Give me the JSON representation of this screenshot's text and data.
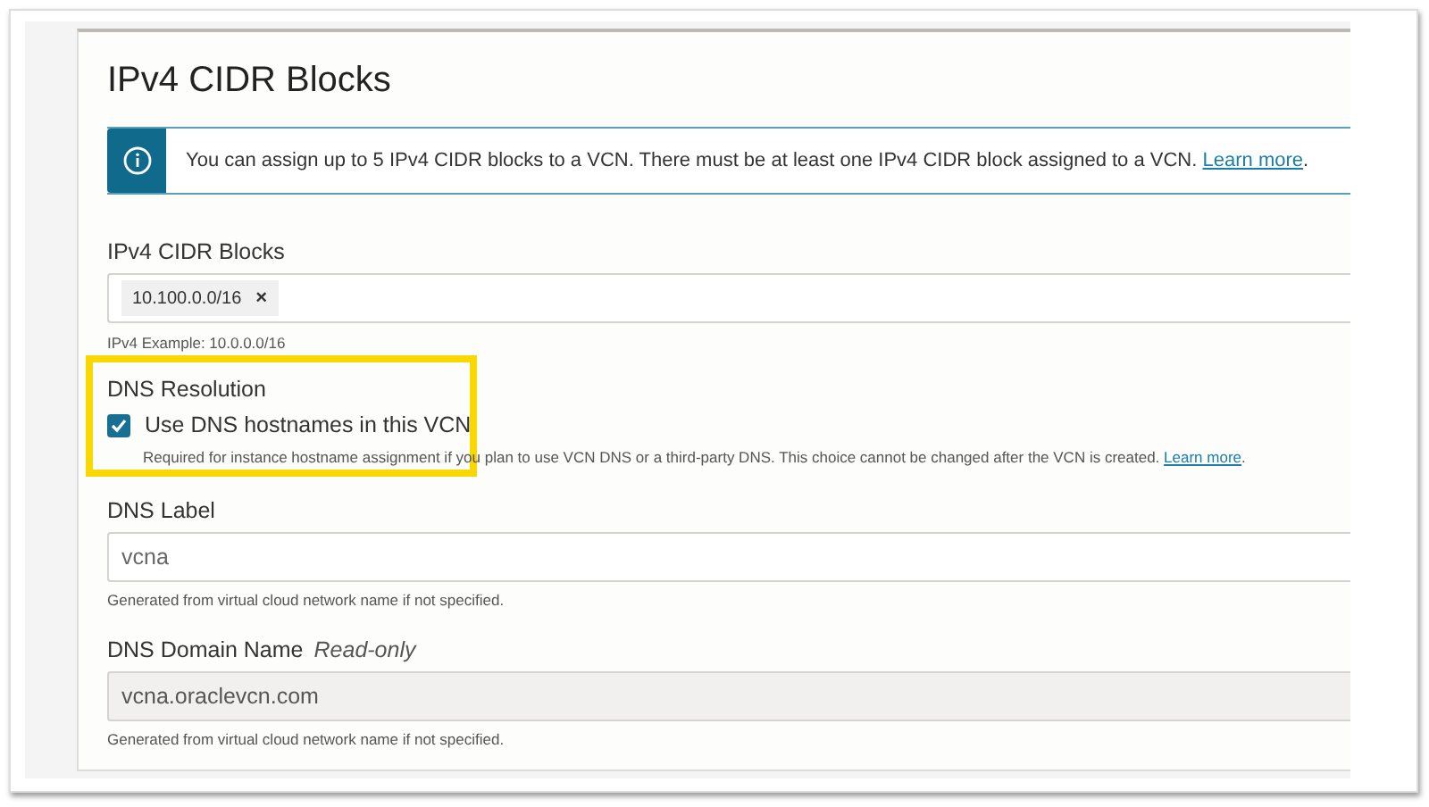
{
  "section": {
    "title": "IPv4 CIDR Blocks"
  },
  "info_banner": {
    "text": "You can assign up to 5 IPv4 CIDR blocks to a VCN. There must be at least one IPv4 CIDR block assigned to a VCN.",
    "link": "Learn more",
    "suffix": "."
  },
  "cidr_field": {
    "label": "IPv4 CIDR Blocks",
    "tags": [
      {
        "text": "10.100.0.0/16",
        "remove": "×"
      }
    ],
    "hint": "IPv4 Example: 10.0.0.0/16"
  },
  "dns_resolution": {
    "label": "DNS Resolution",
    "checkbox": {
      "label": "Use DNS hostnames in this VCN",
      "checked": true
    },
    "help": "Required for instance hostname assignment if you plan to use VCN DNS or a third-party DNS. This choice cannot be changed after the VCN is created.",
    "link": "Learn more",
    "suffix": ".",
    "highlighted": true
  },
  "dns_label": {
    "label": "DNS Label",
    "value": "vcna",
    "hint": "Generated from virtual cloud network name if not specified."
  },
  "dns_domain": {
    "label": "DNS Domain Name",
    "note": "Read-only",
    "value": "vcna.oraclevcn.com",
    "hint": "Generated from virtual cloud network name if not specified.",
    "disabled": true
  }
}
